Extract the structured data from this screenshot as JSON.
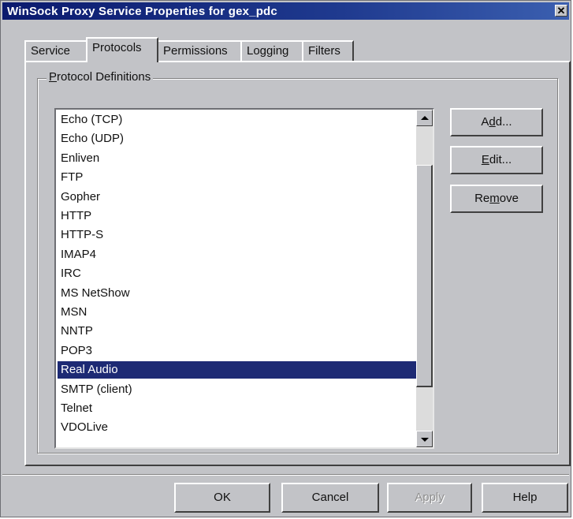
{
  "window": {
    "title": "WinSock Proxy Service Properties for gex_pdc",
    "close_glyph": "✕"
  },
  "tabs": [
    {
      "label": "Service",
      "active": false
    },
    {
      "label": "Protocols",
      "active": true
    },
    {
      "label": "Permissions",
      "active": false
    },
    {
      "label": "Logging",
      "active": false
    },
    {
      "label": "Filters",
      "active": false
    }
  ],
  "protocol_definitions": {
    "group_label": "Protocol Definitions",
    "items": [
      "Echo (TCP)",
      "Echo (UDP)",
      "Enliven",
      "FTP",
      "Gopher",
      "HTTP",
      "HTTP-S",
      "IMAP4",
      "IRC",
      "MS NetShow",
      "MSN",
      "NNTP",
      "POP3",
      "Real Audio",
      "SMTP (client)",
      "Telnet",
      "VDOLive"
    ],
    "selected_item": "Real Audio"
  },
  "side_buttons": {
    "add": {
      "pre": "A",
      "key": "d",
      "post": "d..."
    },
    "edit": {
      "pre": "",
      "key": "E",
      "post": "dit..."
    },
    "remove": {
      "pre": "Re",
      "key": "m",
      "post": "ove"
    }
  },
  "bottom_buttons": {
    "ok": "OK",
    "cancel": "Cancel",
    "apply": "Apply",
    "help": "Help"
  },
  "colors": {
    "dialog_face": "#c2c3c7",
    "title_bar": "#0b1a6e",
    "selection": "#1d2a74"
  },
  "icons": {
    "scroll_up": "up-arrow-icon",
    "scroll_down": "down-arrow-icon",
    "close": "close-icon"
  }
}
